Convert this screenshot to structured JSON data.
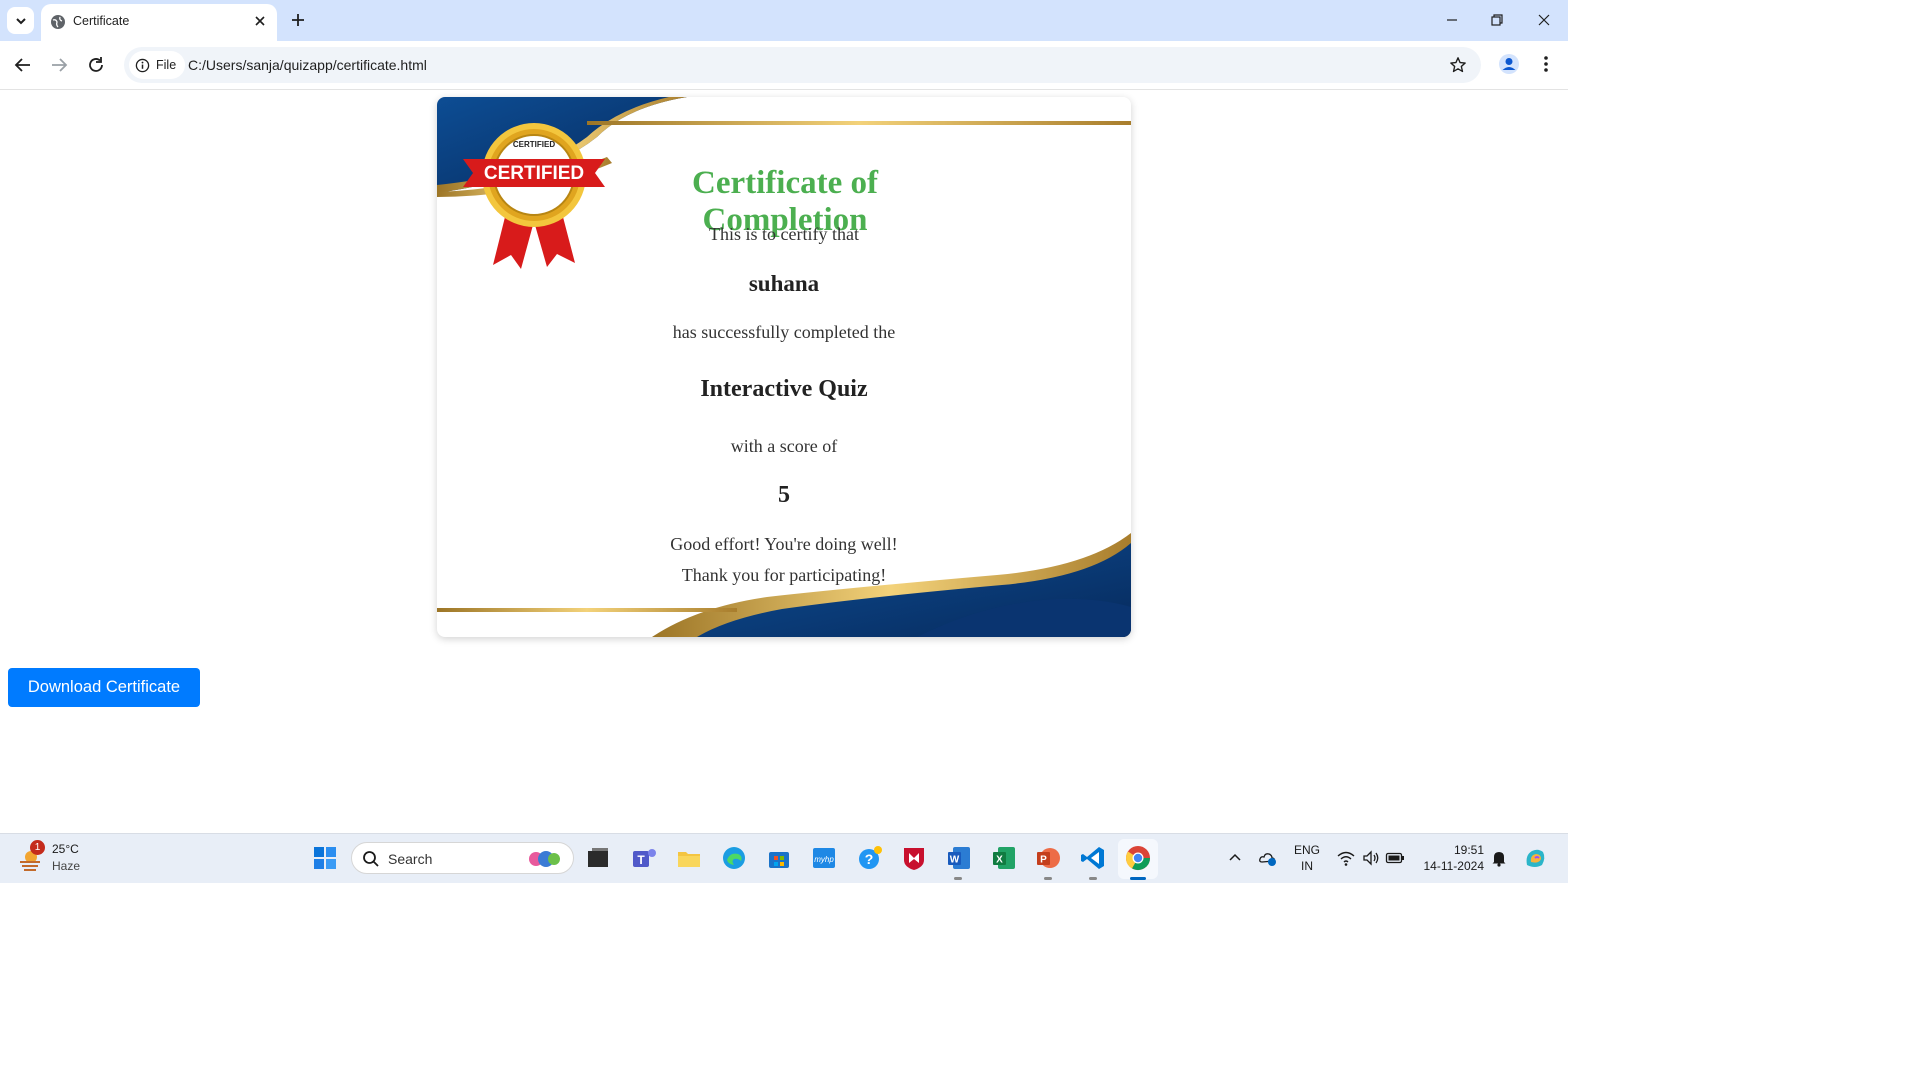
{
  "browser": {
    "tab_title": "Certificate",
    "security_chip_label": "File",
    "url": "C:/Users/sanja/quizapp/certificate.html"
  },
  "certificate": {
    "badge_text": "CERTIFIED",
    "badge_ring_text": "CERTIFIED",
    "title": "Certificate of Completion",
    "intro": "This is to certify that",
    "recipient": "suhana",
    "completed_text": "has successfully completed the",
    "quiz_name": "Interactive Quiz",
    "score_label": "with a score of",
    "score": "5",
    "message": "Good effort! You're doing well!",
    "thanks": "Thank you for participating!",
    "colors": {
      "title": "#4caf50",
      "navy": "#0a3d7a",
      "gold": "#c8a04a"
    }
  },
  "download_button": {
    "label": "Download Certificate",
    "color": "#007bff"
  },
  "taskbar": {
    "weather_temp": "25°C",
    "weather_condition": "Haze",
    "weather_badge": "1",
    "search_label": "Search",
    "language_line1": "ENG",
    "language_line2": "IN",
    "time": "19:51",
    "date": "14-11-2024",
    "apps": [
      "windows-start-icon",
      "file-explorer-dark-icon",
      "teams-icon",
      "folder-icon",
      "edge-icon",
      "store-icon",
      "myhp-icon",
      "help-icon",
      "mcafee-icon",
      "word-icon",
      "excel-icon",
      "powerpoint-icon",
      "vscode-icon",
      "chrome-icon"
    ]
  }
}
